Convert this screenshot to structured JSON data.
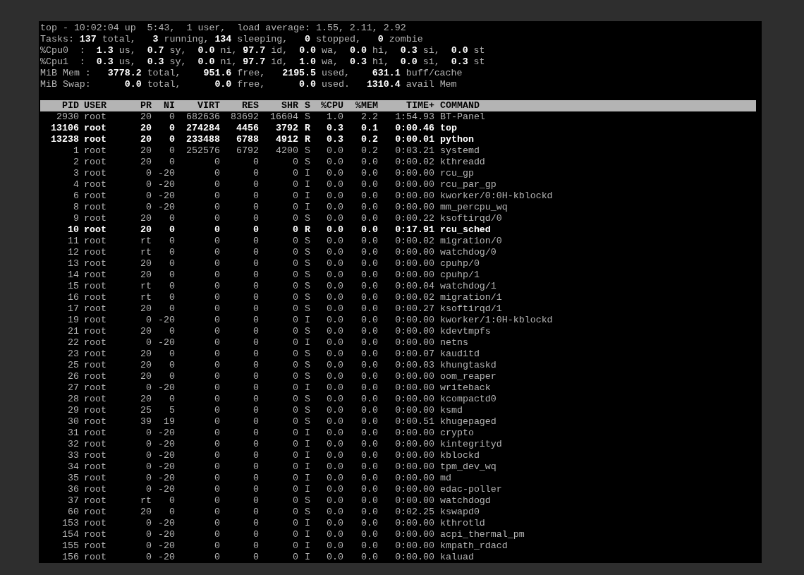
{
  "summary": [
    "top - 10:02:04 up  5:43,  1 user,  load average: 1.55, 2.11, 2.92",
    "Tasks: **137** total,   **3** running, **134** sleeping,   **0** stopped,   **0** zombie",
    "%Cpu0  :  **1.3** us,  **0.7** sy,  **0.0** ni, **97.7** id,  **0.0** wa,  **0.0** hi,  **0.3** si,  **0.0** st",
    "%Cpu1  :  **0.3** us,  **0.3** sy,  **0.0** ni, **97.7** id,  **1.0** wa,  **0.3** hi,  **0.0** si,  **0.3** st",
    "MiB Mem :   **3778.2** total,    **951.6** free,   **2195.5** used,    **631.1** buff/cache",
    "MiB Swap:      **0.0** total,      **0.0** free,      **0.0** used.   **1310.4** avail Mem"
  ],
  "table": {
    "columns": [
      "PID",
      "USER",
      "PR",
      "NI",
      "VIRT",
      "RES",
      "SHR",
      "S",
      "%CPU",
      "%MEM",
      "TIME+",
      "COMMAND"
    ],
    "rows": [
      {
        "cells": [
          "2930",
          "root",
          "20",
          "0",
          "682636",
          "83692",
          "16604",
          "S",
          "1.0",
          "2.2",
          "1:54.93",
          "BT-Panel"
        ],
        "highlighted": false
      },
      {
        "cells": [
          "13106",
          "root",
          "20",
          "0",
          "274284",
          "4456",
          "3792",
          "R",
          "0.3",
          "0.1",
          "0:00.46",
          "top"
        ],
        "highlighted": true
      },
      {
        "cells": [
          "13238",
          "root",
          "20",
          "0",
          "233488",
          "6788",
          "4912",
          "R",
          "0.3",
          "0.2",
          "0:00.01",
          "python"
        ],
        "highlighted": true
      },
      {
        "cells": [
          "1",
          "root",
          "20",
          "0",
          "252576",
          "6792",
          "4200",
          "S",
          "0.0",
          "0.2",
          "0:03.21",
          "systemd"
        ],
        "highlighted": false
      },
      {
        "cells": [
          "2",
          "root",
          "20",
          "0",
          "0",
          "0",
          "0",
          "S",
          "0.0",
          "0.0",
          "0:00.02",
          "kthreadd"
        ],
        "highlighted": false
      },
      {
        "cells": [
          "3",
          "root",
          "0",
          "-20",
          "0",
          "0",
          "0",
          "I",
          "0.0",
          "0.0",
          "0:00.00",
          "rcu_gp"
        ],
        "highlighted": false
      },
      {
        "cells": [
          "4",
          "root",
          "0",
          "-20",
          "0",
          "0",
          "0",
          "I",
          "0.0",
          "0.0",
          "0:00.00",
          "rcu_par_gp"
        ],
        "highlighted": false
      },
      {
        "cells": [
          "6",
          "root",
          "0",
          "-20",
          "0",
          "0",
          "0",
          "I",
          "0.0",
          "0.0",
          "0:00.00",
          "kworker/0:0H-kblockd"
        ],
        "highlighted": false
      },
      {
        "cells": [
          "8",
          "root",
          "0",
          "-20",
          "0",
          "0",
          "0",
          "I",
          "0.0",
          "0.0",
          "0:00.00",
          "mm_percpu_wq"
        ],
        "highlighted": false
      },
      {
        "cells": [
          "9",
          "root",
          "20",
          "0",
          "0",
          "0",
          "0",
          "S",
          "0.0",
          "0.0",
          "0:00.22",
          "ksoftirqd/0"
        ],
        "highlighted": false
      },
      {
        "cells": [
          "10",
          "root",
          "20",
          "0",
          "0",
          "0",
          "0",
          "R",
          "0.0",
          "0.0",
          "0:17.91",
          "rcu_sched"
        ],
        "highlighted": true
      },
      {
        "cells": [
          "11",
          "root",
          "rt",
          "0",
          "0",
          "0",
          "0",
          "S",
          "0.0",
          "0.0",
          "0:00.02",
          "migration/0"
        ],
        "highlighted": false
      },
      {
        "cells": [
          "12",
          "root",
          "rt",
          "0",
          "0",
          "0",
          "0",
          "S",
          "0.0",
          "0.0",
          "0:00.00",
          "watchdog/0"
        ],
        "highlighted": false
      },
      {
        "cells": [
          "13",
          "root",
          "20",
          "0",
          "0",
          "0",
          "0",
          "S",
          "0.0",
          "0.0",
          "0:00.00",
          "cpuhp/0"
        ],
        "highlighted": false
      },
      {
        "cells": [
          "14",
          "root",
          "20",
          "0",
          "0",
          "0",
          "0",
          "S",
          "0.0",
          "0.0",
          "0:00.00",
          "cpuhp/1"
        ],
        "highlighted": false
      },
      {
        "cells": [
          "15",
          "root",
          "rt",
          "0",
          "0",
          "0",
          "0",
          "S",
          "0.0",
          "0.0",
          "0:00.04",
          "watchdog/1"
        ],
        "highlighted": false
      },
      {
        "cells": [
          "16",
          "root",
          "rt",
          "0",
          "0",
          "0",
          "0",
          "S",
          "0.0",
          "0.0",
          "0:00.02",
          "migration/1"
        ],
        "highlighted": false
      },
      {
        "cells": [
          "17",
          "root",
          "20",
          "0",
          "0",
          "0",
          "0",
          "S",
          "0.0",
          "0.0",
          "0:00.27",
          "ksoftirqd/1"
        ],
        "highlighted": false
      },
      {
        "cells": [
          "19",
          "root",
          "0",
          "-20",
          "0",
          "0",
          "0",
          "I",
          "0.0",
          "0.0",
          "0:00.00",
          "kworker/1:0H-kblockd"
        ],
        "highlighted": false
      },
      {
        "cells": [
          "21",
          "root",
          "20",
          "0",
          "0",
          "0",
          "0",
          "S",
          "0.0",
          "0.0",
          "0:00.00",
          "kdevtmpfs"
        ],
        "highlighted": false
      },
      {
        "cells": [
          "22",
          "root",
          "0",
          "-20",
          "0",
          "0",
          "0",
          "I",
          "0.0",
          "0.0",
          "0:00.00",
          "netns"
        ],
        "highlighted": false
      },
      {
        "cells": [
          "23",
          "root",
          "20",
          "0",
          "0",
          "0",
          "0",
          "S",
          "0.0",
          "0.0",
          "0:00.07",
          "kauditd"
        ],
        "highlighted": false
      },
      {
        "cells": [
          "25",
          "root",
          "20",
          "0",
          "0",
          "0",
          "0",
          "S",
          "0.0",
          "0.0",
          "0:00.03",
          "khungtaskd"
        ],
        "highlighted": false
      },
      {
        "cells": [
          "26",
          "root",
          "20",
          "0",
          "0",
          "0",
          "0",
          "S",
          "0.0",
          "0.0",
          "0:00.00",
          "oom_reaper"
        ],
        "highlighted": false
      },
      {
        "cells": [
          "27",
          "root",
          "0",
          "-20",
          "0",
          "0",
          "0",
          "I",
          "0.0",
          "0.0",
          "0:00.00",
          "writeback"
        ],
        "highlighted": false
      },
      {
        "cells": [
          "28",
          "root",
          "20",
          "0",
          "0",
          "0",
          "0",
          "S",
          "0.0",
          "0.0",
          "0:00.00",
          "kcompactd0"
        ],
        "highlighted": false
      },
      {
        "cells": [
          "29",
          "root",
          "25",
          "5",
          "0",
          "0",
          "0",
          "S",
          "0.0",
          "0.0",
          "0:00.00",
          "ksmd"
        ],
        "highlighted": false
      },
      {
        "cells": [
          "30",
          "root",
          "39",
          "19",
          "0",
          "0",
          "0",
          "S",
          "0.0",
          "0.0",
          "0:00.51",
          "khugepaged"
        ],
        "highlighted": false
      },
      {
        "cells": [
          "31",
          "root",
          "0",
          "-20",
          "0",
          "0",
          "0",
          "I",
          "0.0",
          "0.0",
          "0:00.00",
          "crypto"
        ],
        "highlighted": false
      },
      {
        "cells": [
          "32",
          "root",
          "0",
          "-20",
          "0",
          "0",
          "0",
          "I",
          "0.0",
          "0.0",
          "0:00.00",
          "kintegrityd"
        ],
        "highlighted": false
      },
      {
        "cells": [
          "33",
          "root",
          "0",
          "-20",
          "0",
          "0",
          "0",
          "I",
          "0.0",
          "0.0",
          "0:00.00",
          "kblockd"
        ],
        "highlighted": false
      },
      {
        "cells": [
          "34",
          "root",
          "0",
          "-20",
          "0",
          "0",
          "0",
          "I",
          "0.0",
          "0.0",
          "0:00.00",
          "tpm_dev_wq"
        ],
        "highlighted": false
      },
      {
        "cells": [
          "35",
          "root",
          "0",
          "-20",
          "0",
          "0",
          "0",
          "I",
          "0.0",
          "0.0",
          "0:00.00",
          "md"
        ],
        "highlighted": false
      },
      {
        "cells": [
          "36",
          "root",
          "0",
          "-20",
          "0",
          "0",
          "0",
          "I",
          "0.0",
          "0.0",
          "0:00.00",
          "edac-poller"
        ],
        "highlighted": false
      },
      {
        "cells": [
          "37",
          "root",
          "rt",
          "0",
          "0",
          "0",
          "0",
          "S",
          "0.0",
          "0.0",
          "0:00.00",
          "watchdogd"
        ],
        "highlighted": false
      },
      {
        "cells": [
          "60",
          "root",
          "20",
          "0",
          "0",
          "0",
          "0",
          "S",
          "0.0",
          "0.0",
          "0:02.25",
          "kswapd0"
        ],
        "highlighted": false
      },
      {
        "cells": [
          "153",
          "root",
          "0",
          "-20",
          "0",
          "0",
          "0",
          "I",
          "0.0",
          "0.0",
          "0:00.00",
          "kthrotld"
        ],
        "highlighted": false
      },
      {
        "cells": [
          "154",
          "root",
          "0",
          "-20",
          "0",
          "0",
          "0",
          "I",
          "0.0",
          "0.0",
          "0:00.00",
          "acpi_thermal_pm"
        ],
        "highlighted": false
      },
      {
        "cells": [
          "155",
          "root",
          "0",
          "-20",
          "0",
          "0",
          "0",
          "I",
          "0.0",
          "0.0",
          "0:00.00",
          "kmpath_rdacd"
        ],
        "highlighted": false
      },
      {
        "cells": [
          "156",
          "root",
          "0",
          "-20",
          "0",
          "0",
          "0",
          "I",
          "0.0",
          "0.0",
          "0:00.00",
          "kaluad"
        ],
        "highlighted": false
      }
    ]
  }
}
